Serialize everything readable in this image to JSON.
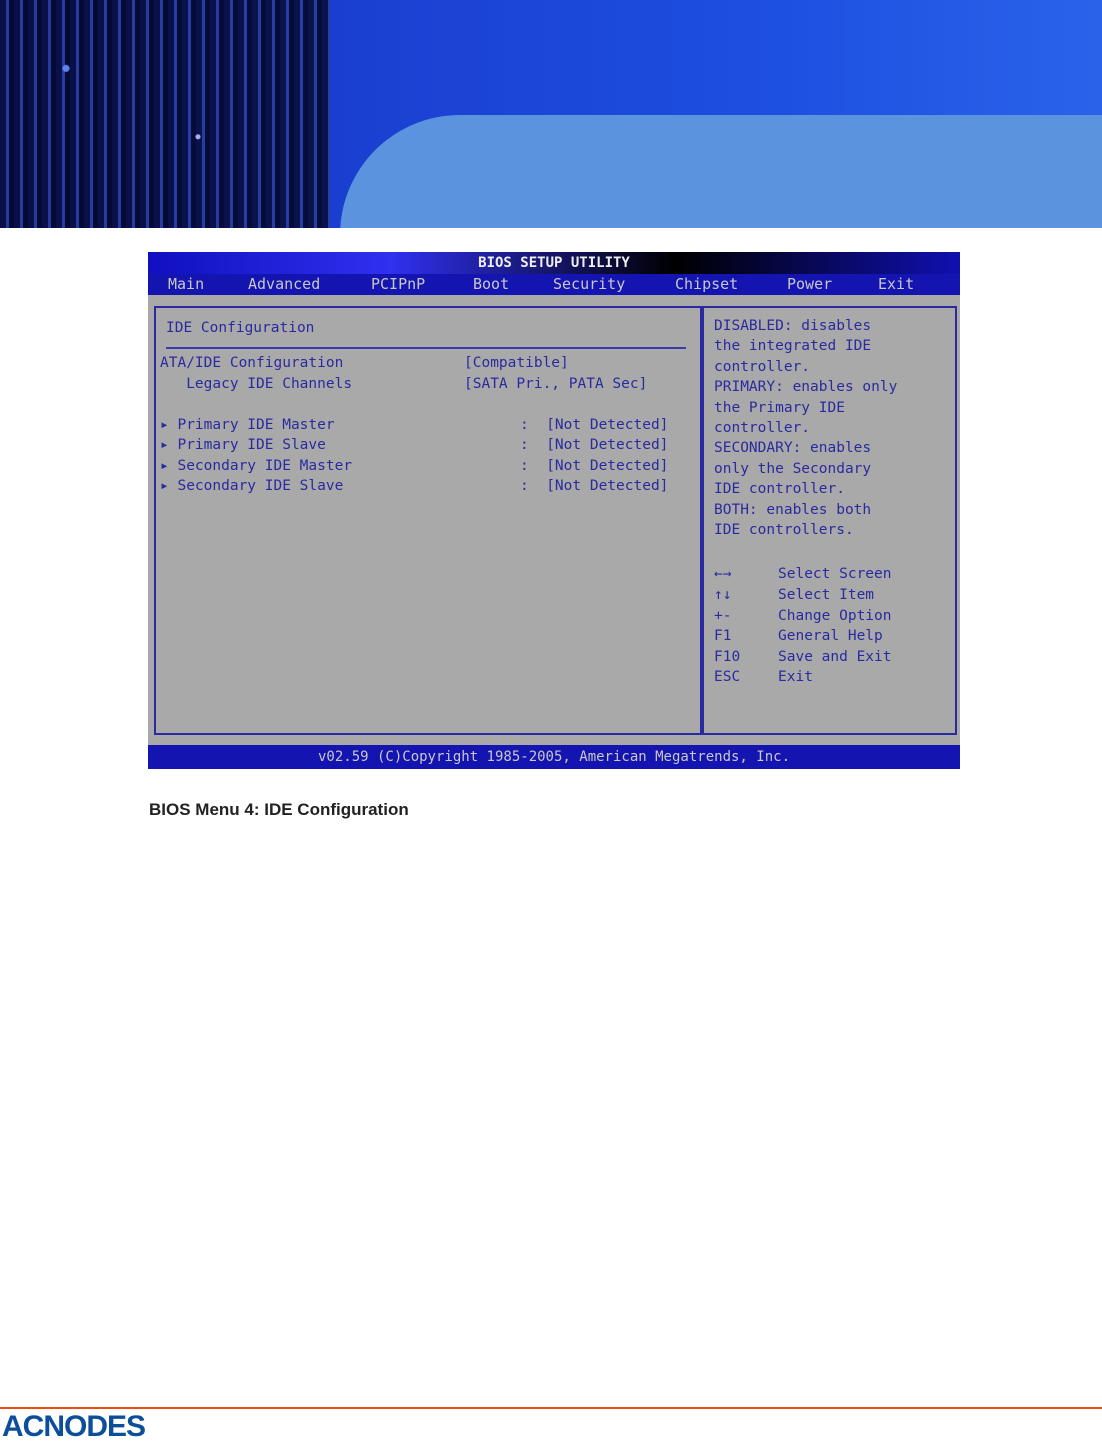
{
  "bios": {
    "title": "BIOS SETUP UTILITY",
    "menu": [
      "Main",
      "Advanced",
      "PCIPnP",
      "Boot",
      "Security",
      "Chipset",
      "Power",
      "Exit"
    ],
    "section": "IDE Configuration",
    "settings": [
      {
        "label": "ATA/IDE Configuration",
        "value": "[Compatible]"
      },
      {
        "label": "   Legacy IDE Channels",
        "value": "[SATA Pri., PATA Sec]"
      }
    ],
    "submenus": [
      {
        "label": "Primary IDE Master",
        "value": ":  [Not Detected]"
      },
      {
        "label": "Primary IDE Slave",
        "value": ":  [Not Detected]"
      },
      {
        "label": "Secondary IDE Master",
        "value": ":  [Not Detected]"
      },
      {
        "label": "Secondary IDE Slave",
        "value": ":  [Not Detected]"
      }
    ],
    "help": [
      "DISABLED: disables",
      "the integrated IDE",
      "controller.",
      "PRIMARY: enables only",
      "the Primary IDE",
      "controller.",
      "SECONDARY: enables",
      "only the Secondary",
      "IDE controller.",
      "BOTH: enables both",
      "IDE controllers."
    ],
    "keys": [
      {
        "key": "←→",
        "action": "Select Screen"
      },
      {
        "key": "↑↓",
        "action": "Select Item"
      },
      {
        "key": "+-",
        "action": "Change Option"
      },
      {
        "key": "F1",
        "action": "General Help"
      },
      {
        "key": "F10",
        "action": "Save and Exit"
      },
      {
        "key": "ESC",
        "action": "Exit"
      }
    ],
    "footer": "v02.59 (C)Copyright 1985-2005, American Megatrends, Inc."
  },
  "caption": "BIOS Menu 4: IDE Configuration",
  "logo": "ACNODES"
}
